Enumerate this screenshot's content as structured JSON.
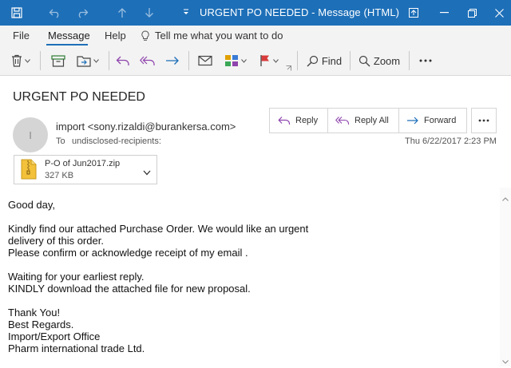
{
  "window": {
    "title": "URGENT PO NEEDED  -  Message (HTML)",
    "accent_color": "#1d6fb8"
  },
  "ribbon": {
    "tabs": [
      {
        "label": "File"
      },
      {
        "label": "Message",
        "active": true
      },
      {
        "label": "Help"
      }
    ],
    "tell_me": "Tell me what you want to do",
    "find_label": "Find",
    "zoom_label": "Zoom"
  },
  "message": {
    "subject": "URGENT PO NEEDED",
    "avatar_initial": "I",
    "from": "import <sony.rizaldi@burankersa.com>",
    "to_label": "To",
    "to": "undisclosed-recipients:",
    "date": "Thu 6/22/2017 2:23 PM",
    "actions": {
      "reply": "Reply",
      "reply_all": "Reply All",
      "forward": "Forward"
    },
    "attachment": {
      "name": "P-O of  Jun2017.zip",
      "size": "327 KB"
    },
    "body": "Good day,\n\nKindly find our attached  Purchase Order. We would like an urgent\ndelivery of this order.\nPlease confirm or acknowledge receipt of my email .\n\nWaiting for your earliest reply.\nKINDLY download the attached file for new proposal.\n\nThank You!\nBest Regards.\nImport/Export Office\nPharm international trade Ltd."
  }
}
